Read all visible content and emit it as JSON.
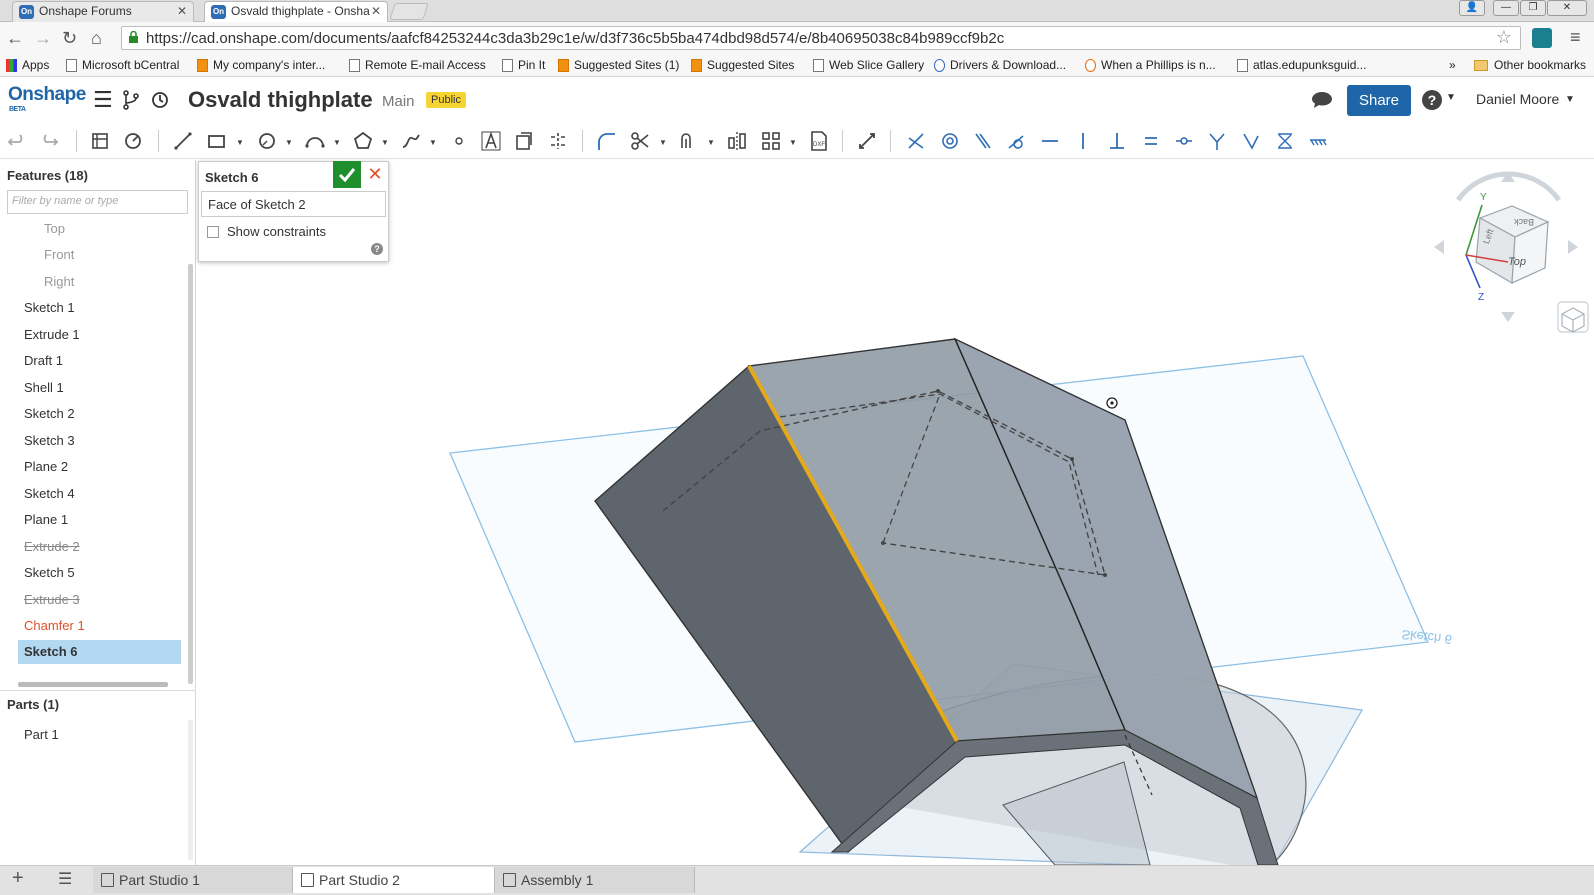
{
  "browser": {
    "tabs": [
      {
        "label": "Onshape Forums",
        "active": false
      },
      {
        "label": "Osvald thighplate - Onsha",
        "active": true
      }
    ],
    "url": "https://cad.onshape.com/documents/aafcf84253244c3da3b29c1e/w/d3f736c5b5ba474dbd98d574/e/8b40695038c84b989ccf9b2c",
    "bookmarks": [
      "Apps",
      "Microsoft bCentral",
      "My company's inter...",
      "Remote E-mail Access",
      "Pin It",
      "Suggested Sites (1)",
      "Suggested Sites",
      "Web Slice Gallery",
      "Drivers & Download...",
      "When a Phillips is n...",
      "atlas.edupunksguid..."
    ],
    "overflow": "»",
    "other_bookmarks": "Other bookmarks"
  },
  "app": {
    "logo": "Onshape",
    "logo_sub": "BETA",
    "doc_title": "Osvald thighplate",
    "branch": "Main",
    "badge": "Public",
    "share": "Share",
    "help": "?",
    "user": "Daniel Moore"
  },
  "features": {
    "header": "Features (18)",
    "filter_placeholder": "Filter by name or type",
    "planes": [
      "Top",
      "Front",
      "Right"
    ],
    "items": [
      "Sketch 1",
      "Extrude 1",
      "Draft 1",
      "Shell 1",
      "Sketch 2",
      "Sketch 3",
      "Plane 2",
      "Sketch 4",
      "Plane 1",
      "Extrude 2",
      "Sketch 5",
      "Extrude 3",
      "Chamfer 1",
      "Sketch 6"
    ],
    "suppressed": [
      "Extrude 2",
      "Extrude 3"
    ],
    "error": "Chamfer 1",
    "selected": "Sketch 6",
    "parts_header": "Parts (1)",
    "parts": [
      "Part 1"
    ]
  },
  "sketch_dialog": {
    "title": "Sketch 6",
    "face": "Face of Sketch 2",
    "show_constraints": "Show constraints",
    "help": "?"
  },
  "viewport": {
    "plane_label": "Sketch 6",
    "viewcube": {
      "top": "Top",
      "left": "Left",
      "back": "Back",
      "axis_y": "Y",
      "axis_z": "Z"
    }
  },
  "bottom_tabs": [
    "Part Studio 1",
    "Part Studio 2",
    "Assembly 1"
  ],
  "active_tab": "Part Studio 2",
  "colors": {
    "brand": "#1f66a8",
    "selected": "#b3d9f2",
    "error": "#e0502a",
    "confirm": "#1f8e2c",
    "badge": "#f6d431",
    "edge_highlight": "#e5a91a"
  }
}
